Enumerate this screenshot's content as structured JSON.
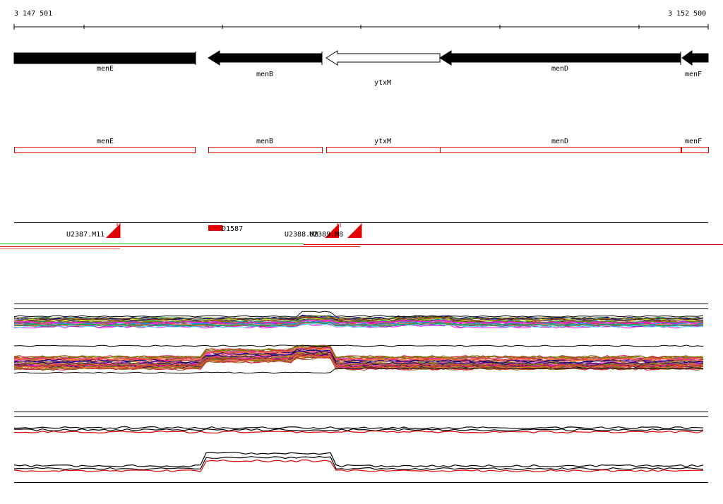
{
  "ruler": {
    "start_label": "3 147 501",
    "end_label": "3 152 500"
  },
  "genes": [
    {
      "name": "menE",
      "strand": "-",
      "fill": "#000000"
    },
    {
      "name": "menB",
      "strand": "-",
      "fill": "#000000"
    },
    {
      "name": "ytxM",
      "strand": "-",
      "fill": "#ffffff"
    },
    {
      "name": "menD",
      "strand": "-",
      "fill": "#000000"
    },
    {
      "name": "menF",
      "strand": "-",
      "fill": "#000000"
    }
  ],
  "gene_boxes": [
    "menE",
    "menB",
    "ytxM",
    "menD",
    "menF"
  ],
  "box_color": "#e00000",
  "features": {
    "u2387": "U2387.M11",
    "d1587": "D1587",
    "u2388": "U2388.M8",
    "u2389": "U2389.M8"
  },
  "colors": {
    "line_black": "#000000",
    "line_red": "#e00000",
    "line_green": "#00cc00",
    "profile_palette": [
      "#e6194b",
      "#3cb44b",
      "#4363d8",
      "#f58231",
      "#911eb4",
      "#46f0f0",
      "#f032e6",
      "#bcf60c",
      "#008080",
      "#9a6324",
      "#800000",
      "#808000",
      "#000075",
      "#ff00ff",
      "#00a0ff",
      "#7a7a00",
      "#ff8080",
      "#00aa55"
    ]
  }
}
